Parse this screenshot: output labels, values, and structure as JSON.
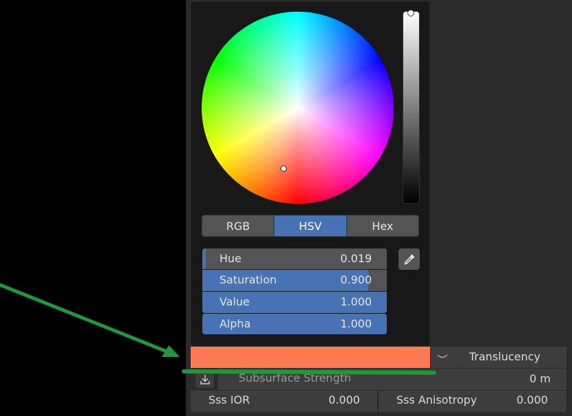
{
  "color_picker": {
    "modes": [
      "RGB",
      "HSV",
      "Hex"
    ],
    "active_mode": "HSV",
    "fields": {
      "hue": {
        "label": "Hue",
        "value": "0.019",
        "level": 0.019
      },
      "saturation": {
        "label": "Saturation",
        "value": "0.900",
        "level": 0.9
      },
      "value": {
        "label": "Value",
        "value": "1.000",
        "level": 1.0
      },
      "alpha": {
        "label": "Alpha",
        "value": "1.000",
        "level": 1.0
      }
    },
    "swatch_color": "#ff7a52",
    "accent_color": "#4772b3",
    "eyedropper_icon": "eyedropper-icon"
  },
  "properties": {
    "translucency_label": "Translucency",
    "subsurface_strength_label": "Subsurface Strength",
    "subsurface_strength_value": "0 m",
    "sss_ior_label": "Sss IOR",
    "sss_ior_value": "0.000",
    "sss_anisotropy_label": "Sss Anisotropy",
    "sss_anisotropy_value": "0.000"
  },
  "annotation": {
    "arrow_color": "#1f9a3a"
  }
}
